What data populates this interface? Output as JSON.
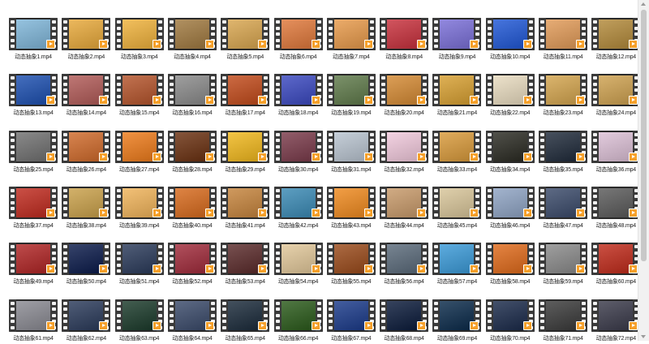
{
  "files": [
    {
      "name": "动态抽象1.mp4",
      "color": "#7fb6d9"
    },
    {
      "name": "动态抽象2.mp4",
      "color": "#e8a93a"
    },
    {
      "name": "动态抽象3.mp4",
      "color": "#f0b23b"
    },
    {
      "name": "动态抽象4.mp4",
      "color": "#a0793f"
    },
    {
      "name": "动态抽象5.mp4",
      "color": "#d9a64f"
    },
    {
      "name": "动态抽象6.mp4",
      "color": "#e0783a"
    },
    {
      "name": "动态抽象7.mp4",
      "color": "#e89a4a"
    },
    {
      "name": "动态抽象8.mp4",
      "color": "#c8303c"
    },
    {
      "name": "动态抽象9.mp4",
      "color": "#7a6fd8"
    },
    {
      "name": "动态抽象10.mp4",
      "color": "#1f57d6"
    },
    {
      "name": "动态抽象11.mp4",
      "color": "#e29b58"
    },
    {
      "name": "动态抽象12.mp4",
      "color": "#b38a3a"
    },
    {
      "name": "动态抽象13.mp4",
      "color": "#1c4fb0"
    },
    {
      "name": "动态抽象14.mp4",
      "color": "#b15a57"
    },
    {
      "name": "动态抽象15.mp4",
      "color": "#b5542b"
    },
    {
      "name": "动态抽象16.mp4",
      "color": "#8a8a8a"
    },
    {
      "name": "动态抽象17.mp4",
      "color": "#c24a1a"
    },
    {
      "name": "动态抽象18.mp4",
      "color": "#3a48c0"
    },
    {
      "name": "动态抽象19.mp4",
      "color": "#5f7a4a"
    },
    {
      "name": "动态抽象20.mp4",
      "color": "#d58a33"
    },
    {
      "name": "动态抽象21.mp4",
      "color": "#d8a031"
    },
    {
      "name": "动态抽象22.mp4",
      "color": "#e9dcc0"
    },
    {
      "name": "动态抽象23.mp4",
      "color": "#d4a54e"
    },
    {
      "name": "动态抽象24.mp4",
      "color": "#cfa250"
    },
    {
      "name": "动态抽象25.mp4",
      "color": "#707070"
    },
    {
      "name": "动态抽象26.mp4",
      "color": "#d06a2a"
    },
    {
      "name": "动态抽象27.mp4",
      "color": "#ee7b1a"
    },
    {
      "name": "动态抽象28.mp4",
      "color": "#6a3010"
    },
    {
      "name": "动态抽象29.mp4",
      "color": "#f1b81c"
    },
    {
      "name": "动态抽象30.mp4",
      "color": "#7a3a4a"
    },
    {
      "name": "动态抽象31.mp4",
      "color": "#b9c4d0"
    },
    {
      "name": "动态抽象32.mp4",
      "color": "#f1c9dc"
    },
    {
      "name": "动态抽象33.mp4",
      "color": "#d99a3a"
    },
    {
      "name": "动态抽象34.mp4",
      "color": "#2a2a22"
    },
    {
      "name": "动态抽象35.mp4",
      "color": "#1f2a3a"
    },
    {
      "name": "动态抽象36.mp4",
      "color": "#dcc0d6"
    },
    {
      "name": "动态抽象37.mp4",
      "color": "#c02a1e"
    },
    {
      "name": "动态抽象38.mp4",
      "color": "#caa14a"
    },
    {
      "name": "动态抽象39.mp4",
      "color": "#f1b45a"
    },
    {
      "name": "动态抽象40.mp4",
      "color": "#d86a1c"
    },
    {
      "name": "动态抽象41.mp4",
      "color": "#c6843c"
    },
    {
      "name": "动态抽象42.mp4",
      "color": "#3a8ab5"
    },
    {
      "name": "动态抽象43.mp4",
      "color": "#f08a1e"
    },
    {
      "name": "动态抽象44.mp4",
      "color": "#c89a6a"
    },
    {
      "name": "动态抽象45.mp4",
      "color": "#d9c69a"
    },
    {
      "name": "动态抽象46.mp4",
      "color": "#8fa4c4"
    },
    {
      "name": "动态抽象47.mp4",
      "color": "#3a4a6a"
    },
    {
      "name": "动态抽象48.mp4",
      "color": "#5a5a5a"
    },
    {
      "name": "动态抽象49.mp4",
      "color": "#b02424"
    },
    {
      "name": "动态抽象50.mp4",
      "color": "#0a1a4a"
    },
    {
      "name": "动态抽象51.mp4",
      "color": "#2a3a5a"
    },
    {
      "name": "动态抽象52.mp4",
      "color": "#a02a3a"
    },
    {
      "name": "动态抽象53.mp4",
      "color": "#5a2a2a"
    },
    {
      "name": "动态抽象54.mp4",
      "color": "#e2c89a"
    },
    {
      "name": "动态抽象55.mp4",
      "color": "#9a4a1a"
    },
    {
      "name": "动态抽象56.mp4",
      "color": "#5a6a7a"
    },
    {
      "name": "动态抽象57.mp4",
      "color": "#3a9ad8"
    },
    {
      "name": "动态抽象58.mp4",
      "color": "#e06a1a"
    },
    {
      "name": "动态抽象59.mp4",
      "color": "#8a8a8a"
    },
    {
      "name": "动态抽象60.mp4",
      "color": "#c02a1a"
    },
    {
      "name": "动态抽象61.mp4",
      "color": "#8a8a92"
    },
    {
      "name": "动态抽象62.mp4",
      "color": "#2a3a5a"
    },
    {
      "name": "动态抽象63.mp4",
      "color": "#1a3a2a"
    },
    {
      "name": "动态抽象64.mp4",
      "color": "#3a4a6a"
    },
    {
      "name": "动态抽象65.mp4",
      "color": "#1a2a3a"
    },
    {
      "name": "动态抽象66.mp4",
      "color": "#2a5a1a"
    },
    {
      "name": "动态抽象67.mp4",
      "color": "#1a3a8a"
    },
    {
      "name": "动态抽象68.mp4",
      "color": "#0a1a3a"
    },
    {
      "name": "动态抽象69.mp4",
      "color": "#0a2a4a"
    },
    {
      "name": "动态抽象70.mp4",
      "color": "#1a2a4a"
    },
    {
      "name": "动态抽象71.mp4",
      "color": "#3a3a3a"
    },
    {
      "name": "动态抽象72.mp4",
      "color": "#3a3a4a"
    }
  ]
}
